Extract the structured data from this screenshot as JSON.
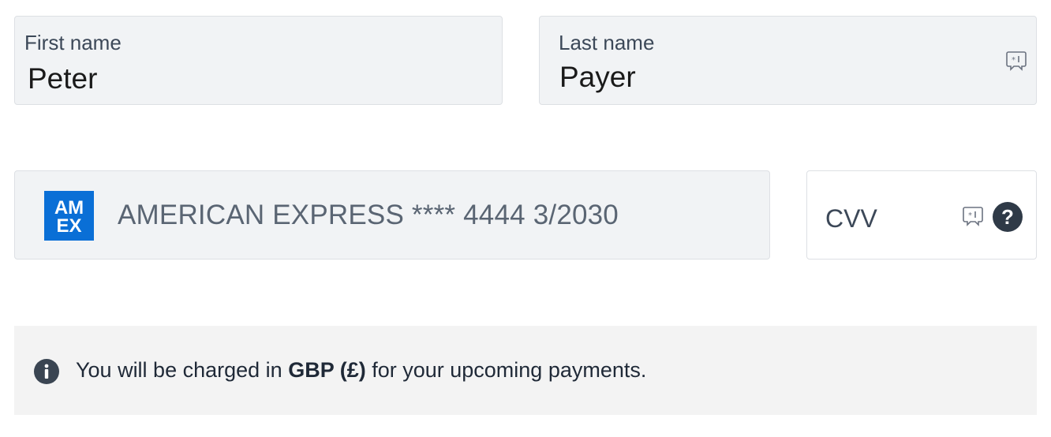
{
  "form": {
    "first_name": {
      "label": "First name",
      "value": "Peter"
    },
    "last_name": {
      "label": "Last name",
      "value": "Payer",
      "icon": "password-manager-icon"
    },
    "card": {
      "brand_logo": "amex-logo",
      "logo_text_top": "AM",
      "logo_text_bottom": "EX",
      "display": "AMERICAN EXPRESS **** 4444 3/2030"
    },
    "cvv": {
      "placeholder": "CVV",
      "icon": "password-manager-icon",
      "help_icon": "question-icon",
      "help_symbol": "?"
    }
  },
  "notice": {
    "icon": "info-icon",
    "text_before": "You will be charged in ",
    "currency": "GBP (£)",
    "text_after": " for your upcoming payments."
  },
  "colors": {
    "field_bg": "#f1f3f5",
    "field_border": "#dde0e4",
    "amex_blue": "#0a6fd6",
    "help_bg": "#2f3a47",
    "notice_bg": "#f3f3f3"
  }
}
